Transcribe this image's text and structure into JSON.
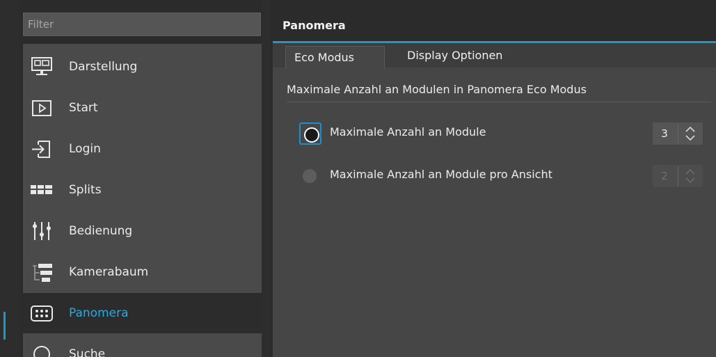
{
  "filter": {
    "placeholder": "Filter"
  },
  "sidebar": {
    "items": [
      {
        "label": "Darstellung",
        "icon": "monitor-icon"
      },
      {
        "label": "Start",
        "icon": "play-icon"
      },
      {
        "label": "Login",
        "icon": "login-icon"
      },
      {
        "label": "Splits",
        "icon": "splits-icon"
      },
      {
        "label": "Bedienung",
        "icon": "sliders-icon"
      },
      {
        "label": "Kamerabaum",
        "icon": "camera-tree-icon"
      },
      {
        "label": "Panomera",
        "icon": "panomera-icon",
        "selected": true
      },
      {
        "label": "Suche",
        "icon": "search-icon"
      }
    ]
  },
  "panel": {
    "title": "Panomera",
    "tabs": [
      {
        "label": "Eco Modus",
        "active": true
      },
      {
        "label": "Display Optionen",
        "active": false
      }
    ],
    "section_title": "Maximale Anzahl an Modulen in Panomera Eco Modus",
    "options": [
      {
        "label": "Maximale Anzahl an Module",
        "selected": true,
        "value": "3",
        "enabled": true
      },
      {
        "label": "Maximale Anzahl an Module pro Ansicht",
        "selected": false,
        "value": "2",
        "enabled": false
      }
    ]
  },
  "colors": {
    "accent": "#2196c9",
    "active_label": "#2aa9e0"
  }
}
